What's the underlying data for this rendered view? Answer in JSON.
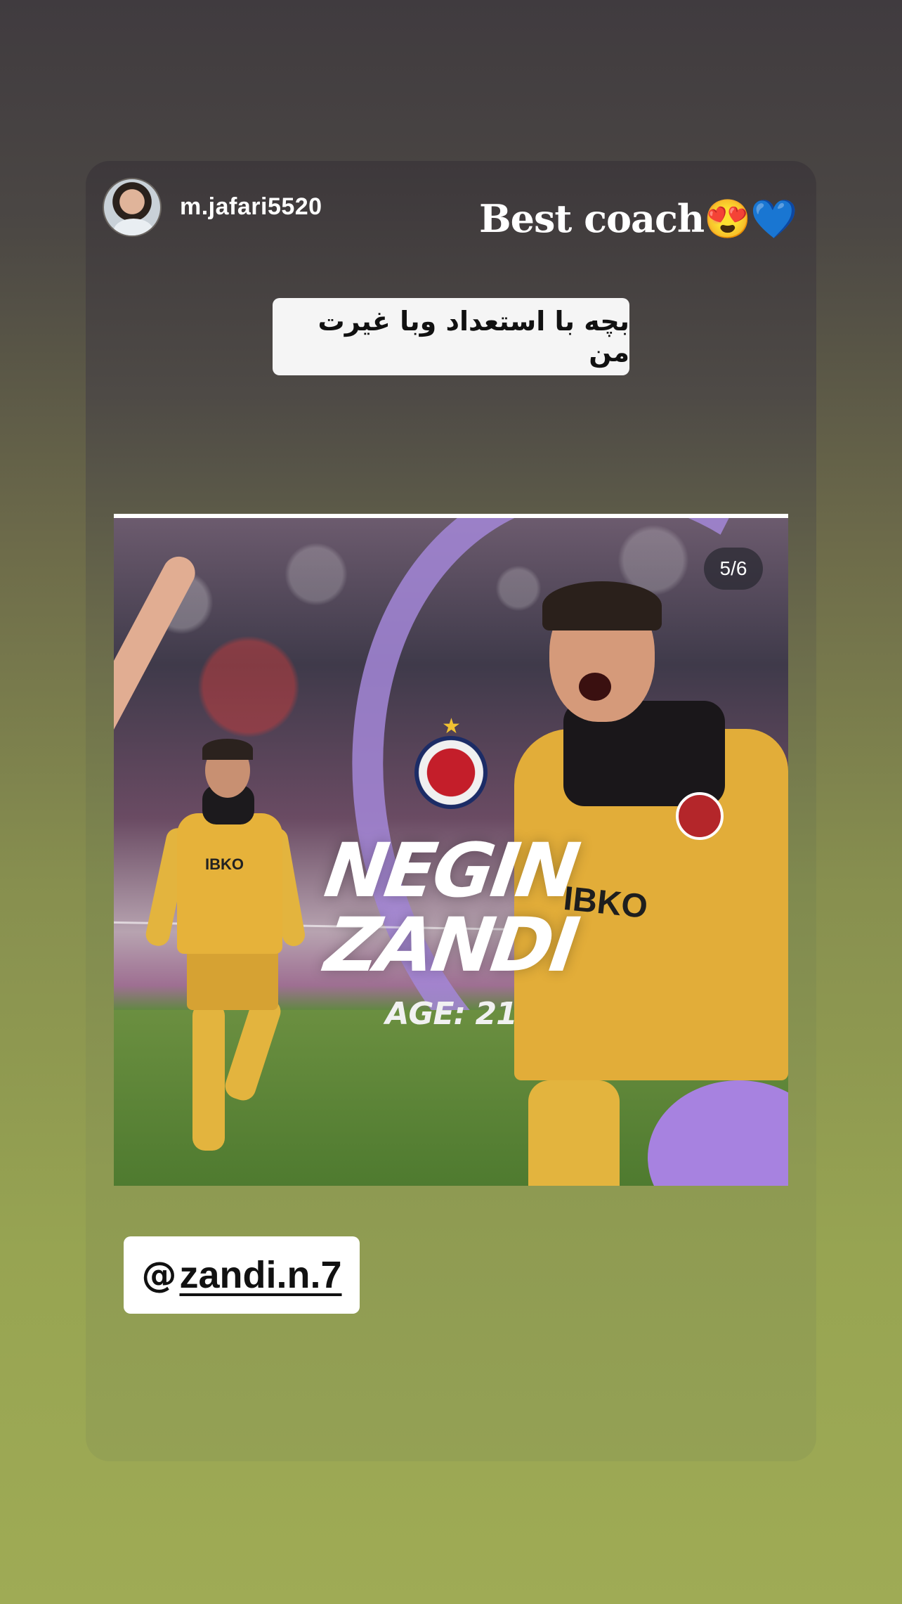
{
  "story": {
    "username": "m.jafari5520",
    "caption": "Best coach😍💙",
    "question_sticker": "بچه با استعداد وبا غیرت من",
    "mention": {
      "icon": "threads-icon",
      "icon_glyph": "@",
      "handle": "zandi.n.7"
    }
  },
  "post": {
    "counter": "5/6",
    "player_first_name": "NEGIN",
    "player_last_name": "ZANDI",
    "age_text": "AGE: 21",
    "colors": {
      "accent_purple": "#a487d8",
      "kit_yellow": "#e2ad39"
    }
  }
}
